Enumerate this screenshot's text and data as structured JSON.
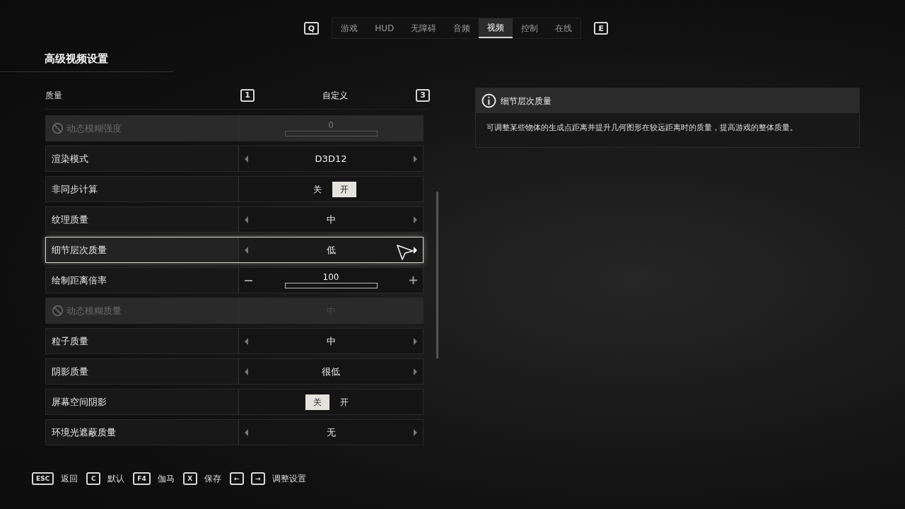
{
  "tabs": {
    "prev_key": "Q",
    "next_key": "E",
    "items": [
      {
        "label": "游戏",
        "selected": false
      },
      {
        "label": "HUD",
        "selected": false
      },
      {
        "label": "无障碍",
        "selected": false
      },
      {
        "label": "音频",
        "selected": false
      },
      {
        "label": "视频",
        "selected": true
      },
      {
        "label": "控制",
        "selected": false
      },
      {
        "label": "在线",
        "selected": false
      }
    ]
  },
  "section_title": "高级视频设置",
  "preset": {
    "label": "质量",
    "prev_key": "1",
    "value": "自定义",
    "next_key": "3"
  },
  "settings": [
    {
      "kind": "slider",
      "label": "动态模糊强度",
      "value": "0",
      "level": 0,
      "disabled": true,
      "selected": false
    },
    {
      "kind": "selector",
      "label": "渲染模式",
      "value": "D3D12",
      "disabled": false,
      "selected": false
    },
    {
      "kind": "toggle",
      "label": "非同步计算",
      "options": [
        {
          "label": "关",
          "selected": false
        },
        {
          "label": "开",
          "selected": true
        }
      ],
      "disabled": false,
      "selected": false
    },
    {
      "kind": "selector",
      "label": "纹理质量",
      "value": "中",
      "disabled": false,
      "selected": false
    },
    {
      "kind": "selector",
      "label": "细节层次质量",
      "value": "低",
      "disabled": false,
      "selected": true
    },
    {
      "kind": "slider",
      "label": "绘制距离倍率",
      "value": "100",
      "level": 0,
      "disabled": false,
      "selected": false
    },
    {
      "kind": "selector",
      "label": "动态模糊质量",
      "value": "中",
      "disabled": true,
      "selected": false
    },
    {
      "kind": "selector",
      "label": "粒子质量",
      "value": "中",
      "disabled": false,
      "selected": false
    },
    {
      "kind": "selector",
      "label": "阴影质量",
      "value": "很低",
      "disabled": false,
      "selected": false
    },
    {
      "kind": "toggle",
      "label": "屏幕空间阴影",
      "options": [
        {
          "label": "关",
          "selected": true
        },
        {
          "label": "开",
          "selected": false
        }
      ],
      "disabled": false,
      "selected": false
    },
    {
      "kind": "selector",
      "label": "环境光遮蔽质量",
      "value": "无",
      "disabled": false,
      "selected": false
    }
  ],
  "info": {
    "title": "细节层次质量",
    "description": "可调整某些物体的生成点距离并提升几何图形在较远距离时的质量，提高游戏的整体质量。"
  },
  "footer": [
    {
      "keys": [
        "ESC"
      ],
      "label": "返回"
    },
    {
      "keys": [
        "C"
      ],
      "label": "默认"
    },
    {
      "keys": [
        "F4"
      ],
      "label": "伽马"
    },
    {
      "keys": [
        "X"
      ],
      "label": "保存"
    },
    {
      "keys": [
        "←",
        "→"
      ],
      "label": "调整设置"
    }
  ]
}
